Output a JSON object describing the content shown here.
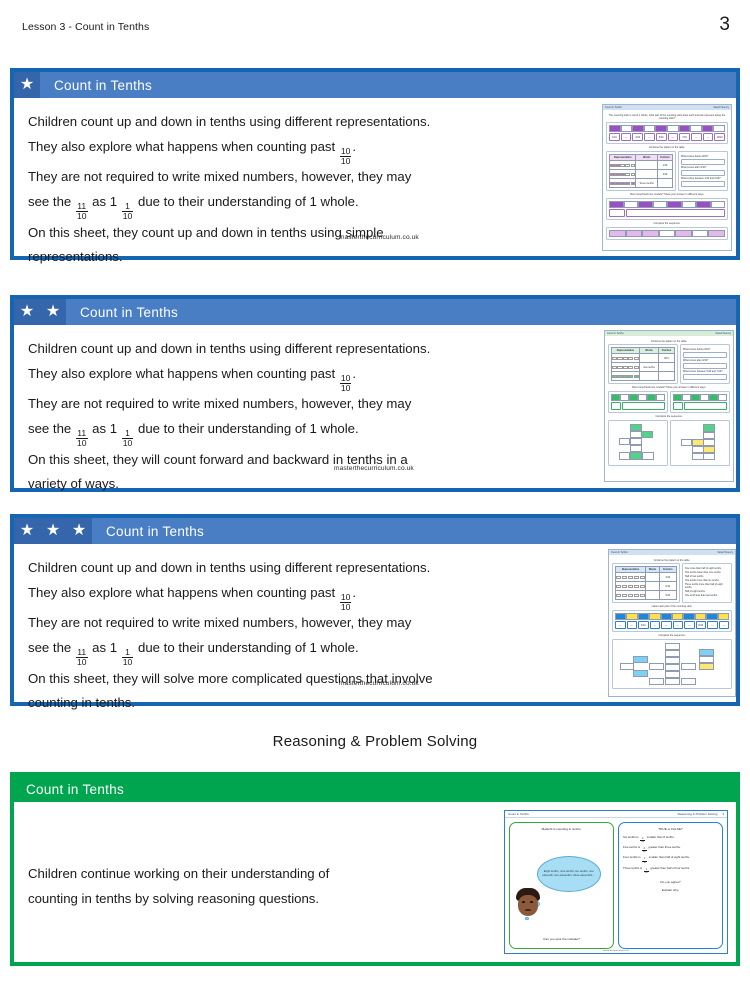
{
  "header": {
    "doc_title": "Lesson 3 - Count in Tenths",
    "page_number": "3"
  },
  "section_title": "Reasoning & Problem Solving",
  "credit": "masterthecurriculum.co.uk",
  "colors": {
    "blue_header": "#4a7ec4",
    "blue_border": "#1565b0",
    "star_box": "#3566ab",
    "green_header": "#00a64f",
    "green_border": "#00a64f"
  },
  "cards": [
    {
      "title": "Count in Tenths",
      "stars": 1,
      "star_glyph": "★",
      "accent": "blue",
      "lines": [
        "Children count up and down in tenths using different representations.",
        "They also explore what happens when counting past ",
        "They are not required to write mixed numbers, however, they may",
        "see the ",
        "On this sheet, they count up and down in tenths using simple",
        "representations."
      ],
      "line2_frac": {
        "num": "10",
        "den": "10"
      },
      "line2_tail": ".",
      "line4_frac_a": {
        "num": "11",
        "den": "10"
      },
      "line4_mid": " as  1 ",
      "line4_frac_b": {
        "num": "1",
        "den": "10"
      },
      "line4_tail": " due to their understanding of 1 whole.",
      "thumb": {
        "bar_left": "Count in Tenths",
        "bar_right": "Varied Fluency",
        "caption1": "The counting stick is worth 1 whole, what part of the counting stick does each interval represent along the counting stick?",
        "caption2": "Continue the pattern in the table.",
        "caption3": "How many/how/more models? Show your answer in different ways.",
        "caption4": "Complete the sequence.",
        "table_headers": [
          "Representation",
          "Words",
          "Fraction"
        ],
        "table_word_cell": "Seven tenths",
        "question_labels": [
          "What comes before 8/10?",
          "What comes after 3/10?",
          "What comes between 4/10 and 6/10?"
        ],
        "strip_fracs": [
          "1/10",
          "3/10",
          "5/10",
          "7/10",
          "10/10"
        ]
      }
    },
    {
      "title": "Count in Tenths",
      "stars": 2,
      "star_glyph": "★",
      "accent": "blue",
      "lines": [
        "Children count up and down in tenths using different representations.",
        "They also explore what happens when counting past ",
        "They are not required to write mixed numbers, however, they may",
        "see the ",
        "On this sheet, they will count forward and backward in tenths in a",
        "variety of ways."
      ],
      "line2_frac": {
        "num": "10",
        "den": "10"
      },
      "line2_tail": ".",
      "line4_frac_a": {
        "num": "11",
        "den": "10"
      },
      "line4_mid": " as  1 ",
      "line4_frac_b": {
        "num": "1",
        "den": "10"
      },
      "line4_tail": " due to their understanding of 1 whole.",
      "thumb": {
        "bar_left": "Count in Tenths",
        "bar_right": "Varied Fluency",
        "caption1": "Continue the pattern in the table.",
        "caption2": "How many/how/more models? Show your answer in different ways.",
        "caption3": "Complete the sequence.",
        "table_headers": [
          "Representation",
          "Words",
          "Fraction"
        ],
        "table_word_cell": "nine tenths",
        "question_labels": [
          "What comes before 9/10?",
          "What comes after 2/10?",
          "What comes between 5/10 and 7/10?"
        ]
      }
    },
    {
      "title": "Count in Tenths",
      "stars": 3,
      "star_glyph": "★",
      "accent": "blue",
      "lines": [
        "Children count up and down in tenths using different representations.",
        "They also explore what happens when counting past ",
        "They are not required to write mixed numbers, however, they may",
        "see the ",
        "On this sheet, they will solve more complicated questions that involve",
        "counting in tenths."
      ],
      "line2_frac": {
        "num": "10",
        "den": "10"
      },
      "line2_tail": ".",
      "line4_frac_a": {
        "num": "11",
        "den": "10"
      },
      "line4_mid": " as  1 ",
      "line4_frac_b": {
        "num": "1",
        "den": "10"
      },
      "line4_tail": " due to their understanding of 1 whole.",
      "thumb": {
        "bar_left": "Count in Tenths",
        "bar_right": "Varied Fluency",
        "caption1": "Continue the pattern or the table.",
        "caption2": "Label each part of the counting stick.",
        "caption3": "Complete the sequence.",
        "table_headers": [
          "Representation",
          "Words",
          "Fraction"
        ],
        "clue_lines": [
          "One more than half of eight tenths.",
          "Two tenths fewer than nine tenths.",
          "Half of two tenths.",
          "Two tenths more than six tenths.",
          "Three tenths more than half of eight tenths.",
          "Half of eight tenths.",
          "One tenth less than two tenths."
        ],
        "strip_fracs": [
          "3/10",
          "8/10"
        ]
      }
    }
  ],
  "reasoning_card": {
    "title": "Count in Tenths",
    "accent": "green",
    "stars": 0,
    "lines": [
      "Children continue working on their understanding of",
      "counting in tenths by solving reasoning questions."
    ],
    "thumb": {
      "bar_left": "Count in Tenths",
      "bar_right": "Reasoning & Problem Solving",
      "page_num": "3",
      "left_panel": {
        "prompt": "Malachi is counting in tenths.",
        "bubble": "Eight tenths, nine tenths, ten tenths, one eleventh, two elevenths, three elevenths…",
        "question": "Can you spot the mistake?"
      },
      "right_panel": {
        "heading": "TRUE  or  FALSE?",
        "statements": [
          {
            "pre": "Six tenths is ",
            "num": "2",
            "den": "10",
            "post": " smaller than 8 tenths."
          },
          {
            "pre": "Five tenths is ",
            "num": "2",
            "den": "10",
            "post": " greater than three tenths."
          },
          {
            "pre": "Four tenths is ",
            "num": "1",
            "den": "10",
            "post": " smaller than half of eight tenths."
          },
          {
            "pre": "Three tenths is ",
            "num": "1",
            "den": "10",
            "post": " greater than half of four tenths."
          }
        ],
        "q1": "Do you agree?",
        "q2": "Explain why."
      },
      "credit": "masterthecurriculum.co.uk"
    }
  }
}
